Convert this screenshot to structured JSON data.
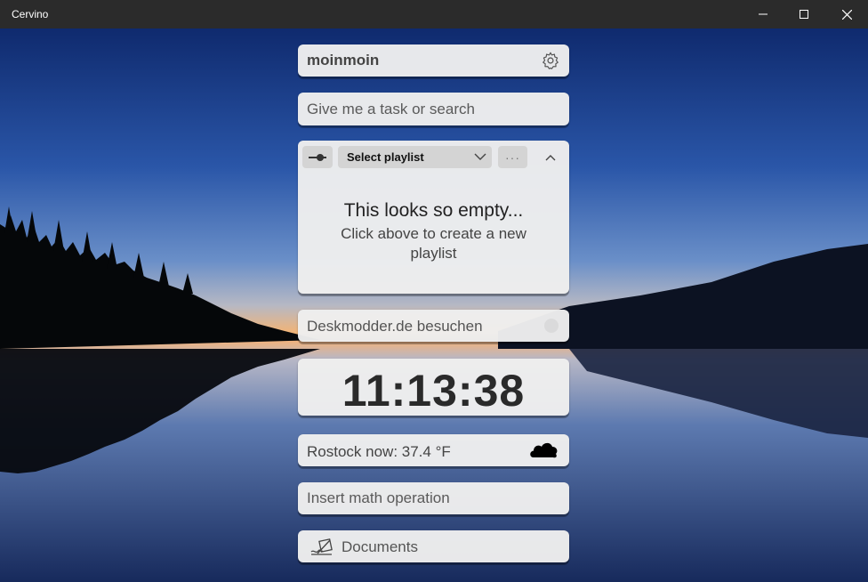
{
  "window": {
    "title": "Cervino",
    "controls": [
      "minimize-icon",
      "maximize-icon",
      "close-icon"
    ]
  },
  "greeting": {
    "text": "moinmoin",
    "icon": "gear-icon"
  },
  "search": {
    "placeholder": "Give me a task or search"
  },
  "playlist": {
    "select_label": "Select playlist",
    "more_label": "···",
    "empty_title": "This looks so empty...",
    "empty_subtitle": "Click above to create a new playlist"
  },
  "link": {
    "text": "Deskmodder.de besuchen"
  },
  "clock": {
    "time": "11:13:38"
  },
  "weather": {
    "text": "Rostock now: 37.4 °F",
    "icon": "cloud-icon"
  },
  "math": {
    "placeholder": "Insert math operation"
  },
  "documents": {
    "label": "Documents",
    "icon": "documents-icon"
  },
  "colors": {
    "titlebar": "#2b2b2b",
    "card": "#eeeeee",
    "sky_top": "#1b3a86",
    "horizon": "#f0a35a"
  }
}
